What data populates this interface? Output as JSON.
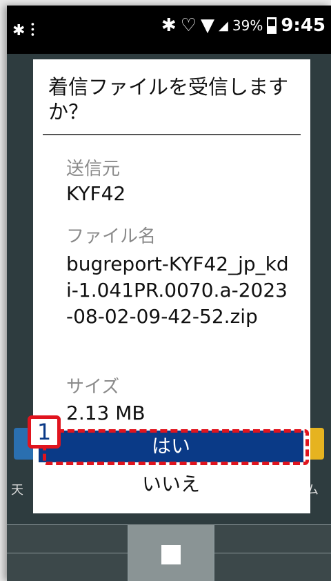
{
  "status_bar": {
    "left_icon": "bluetooth-signal-icon",
    "battery_percent": "39%",
    "time": "9:45",
    "icons": [
      "bluetooth-icon",
      "heart-lock-icon",
      "wifi-icon",
      "signal-icon",
      "battery-icon"
    ]
  },
  "home": {
    "left_label": "天",
    "right_label": "ム"
  },
  "dialog": {
    "title": "着信ファイルを受信しますか？",
    "sender_label": "送信元",
    "sender_value": "KYF42",
    "filename_label": "ファイル名",
    "filename_value": "bugreport-KYF42_jp_kdi-1.041PR.0070.a-2023-08-02-09-42-52.zip",
    "size_label": "サイズ",
    "size_value": "2.13 MB",
    "yes_label": "はい",
    "no_label": "いいえ"
  },
  "annotation": {
    "step_number": "1",
    "highlight_color": "#e0141e"
  },
  "colors": {
    "primary_button": "#0a3a87",
    "background_dim": "#2e3c3f"
  }
}
